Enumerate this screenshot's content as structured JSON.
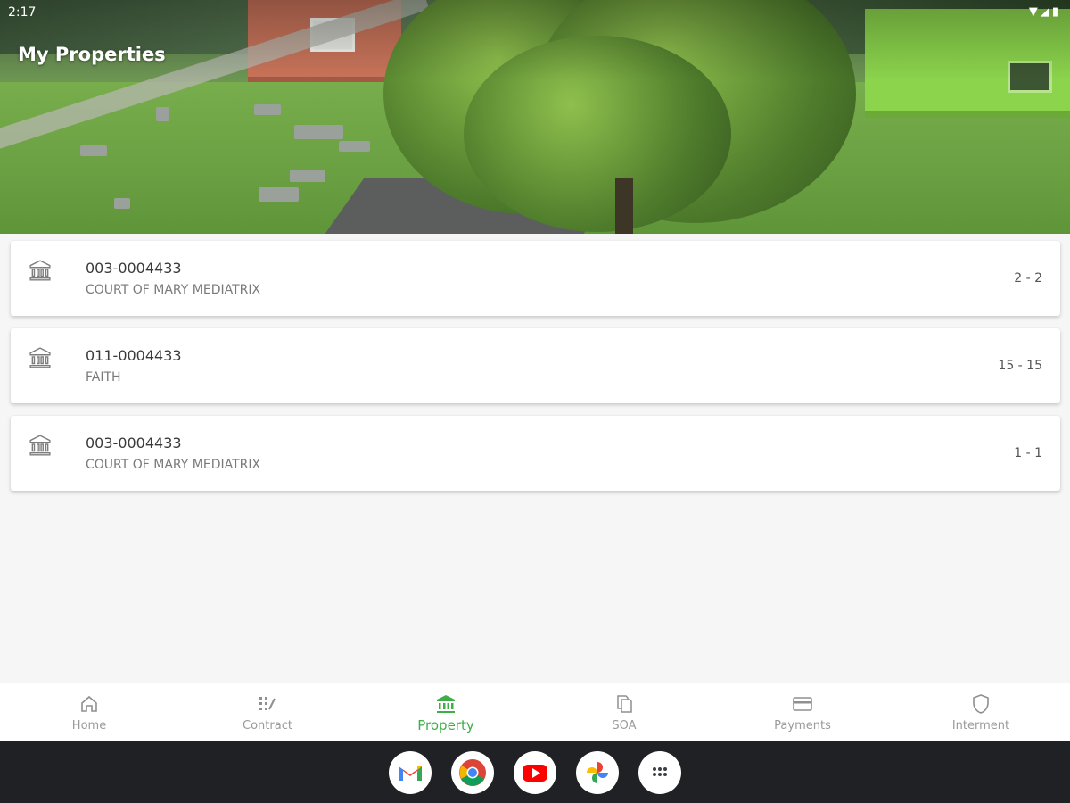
{
  "status_bar": {
    "time": "2:17"
  },
  "header": {
    "title": "My Properties"
  },
  "properties": [
    {
      "code": "003-0004433",
      "name": "COURT OF MARY MEDIATRIX",
      "range": "2 - 2"
    },
    {
      "code": "011-0004433",
      "name": "FAITH",
      "range": "15 - 15"
    },
    {
      "code": "003-0004433",
      "name": "COURT OF MARY MEDIATRIX",
      "range": "1 - 1"
    }
  ],
  "bottom_nav": {
    "items": [
      {
        "label": "Home",
        "icon": "home-icon"
      },
      {
        "label": "Contract",
        "icon": "contract-icon"
      },
      {
        "label": "Property",
        "icon": "bank-icon",
        "active": true
      },
      {
        "label": "SOA",
        "icon": "copy-file-icon"
      },
      {
        "label": "Payments",
        "icon": "card-icon"
      },
      {
        "label": "Interment",
        "icon": "shield-icon"
      }
    ],
    "active_color": "#3fae49",
    "inactive_color": "#9a9a9a"
  },
  "dock": {
    "apps": [
      "gmail-icon",
      "chrome-icon",
      "youtube-icon",
      "photos-icon",
      "app-drawer-icon"
    ]
  }
}
